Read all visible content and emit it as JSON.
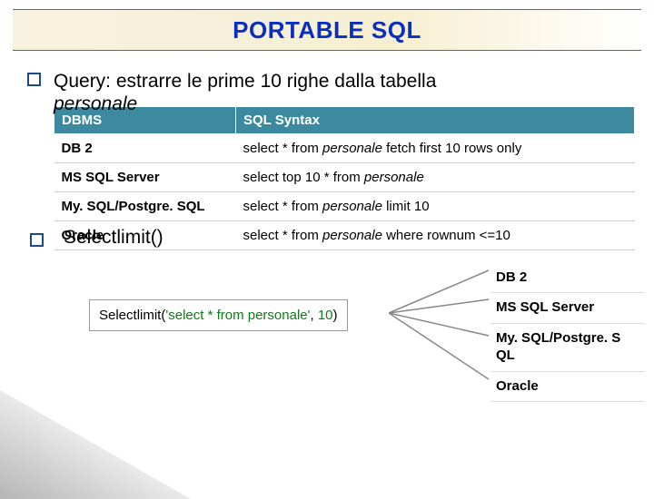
{
  "title": "PORTABLE SQL",
  "query_line": "Query: estrarre le prime 10 righe dalla tabella",
  "query_table": "personale",
  "table": {
    "headers": {
      "dbms": "DBMS",
      "syntax": "SQL Syntax"
    },
    "rows": [
      {
        "dbms": "DB 2",
        "p1": "select * from ",
        "it": "personale ",
        "p2": "fetch first 10 rows only"
      },
      {
        "dbms": "MS SQL Server",
        "p1": "select top 10 * from ",
        "it": "personale",
        "p2": ""
      },
      {
        "dbms": "My. SQL/Postgre. SQL",
        "p1": "select * from ",
        "it": "personale ",
        "p2": "limit 10"
      },
      {
        "dbms": "Oracle",
        "p1": "select * from ",
        "it": "personale ",
        "p2": "where rownum <=10"
      }
    ]
  },
  "selectlimit_label": "Selectlimit()",
  "call": {
    "fn": "Selectlimit(",
    "arg_sql": "'select * from personale'",
    "sep": ", ",
    "arg_n": "10",
    "close": ")"
  },
  "targets": [
    "DB 2",
    "MS SQL Server",
    "My. SQL/Postgre. S QL",
    "Oracle"
  ]
}
